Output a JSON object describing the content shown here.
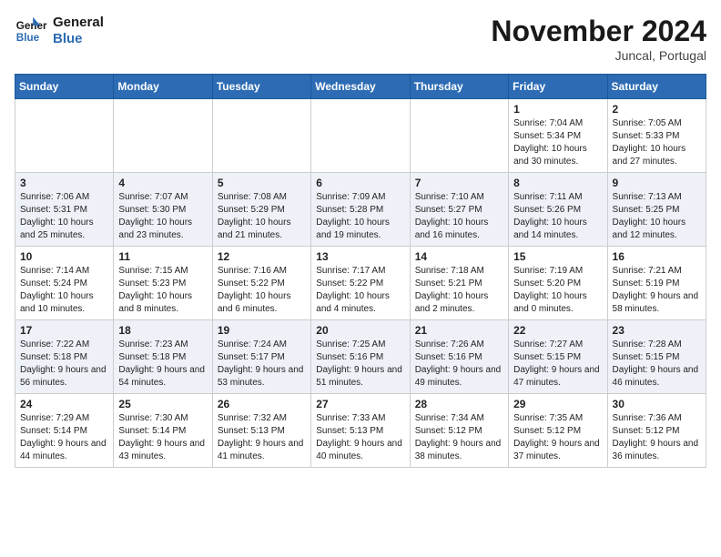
{
  "header": {
    "logo_line1": "General",
    "logo_line2": "Blue",
    "month": "November 2024",
    "location": "Juncal, Portugal"
  },
  "days_of_week": [
    "Sunday",
    "Monday",
    "Tuesday",
    "Wednesday",
    "Thursday",
    "Friday",
    "Saturday"
  ],
  "weeks": [
    [
      {
        "day": "",
        "info": ""
      },
      {
        "day": "",
        "info": ""
      },
      {
        "day": "",
        "info": ""
      },
      {
        "day": "",
        "info": ""
      },
      {
        "day": "",
        "info": ""
      },
      {
        "day": "1",
        "info": "Sunrise: 7:04 AM\nSunset: 5:34 PM\nDaylight: 10 hours and 30 minutes."
      },
      {
        "day": "2",
        "info": "Sunrise: 7:05 AM\nSunset: 5:33 PM\nDaylight: 10 hours and 27 minutes."
      }
    ],
    [
      {
        "day": "3",
        "info": "Sunrise: 7:06 AM\nSunset: 5:31 PM\nDaylight: 10 hours and 25 minutes."
      },
      {
        "day": "4",
        "info": "Sunrise: 7:07 AM\nSunset: 5:30 PM\nDaylight: 10 hours and 23 minutes."
      },
      {
        "day": "5",
        "info": "Sunrise: 7:08 AM\nSunset: 5:29 PM\nDaylight: 10 hours and 21 minutes."
      },
      {
        "day": "6",
        "info": "Sunrise: 7:09 AM\nSunset: 5:28 PM\nDaylight: 10 hours and 19 minutes."
      },
      {
        "day": "7",
        "info": "Sunrise: 7:10 AM\nSunset: 5:27 PM\nDaylight: 10 hours and 16 minutes."
      },
      {
        "day": "8",
        "info": "Sunrise: 7:11 AM\nSunset: 5:26 PM\nDaylight: 10 hours and 14 minutes."
      },
      {
        "day": "9",
        "info": "Sunrise: 7:13 AM\nSunset: 5:25 PM\nDaylight: 10 hours and 12 minutes."
      }
    ],
    [
      {
        "day": "10",
        "info": "Sunrise: 7:14 AM\nSunset: 5:24 PM\nDaylight: 10 hours and 10 minutes."
      },
      {
        "day": "11",
        "info": "Sunrise: 7:15 AM\nSunset: 5:23 PM\nDaylight: 10 hours and 8 minutes."
      },
      {
        "day": "12",
        "info": "Sunrise: 7:16 AM\nSunset: 5:22 PM\nDaylight: 10 hours and 6 minutes."
      },
      {
        "day": "13",
        "info": "Sunrise: 7:17 AM\nSunset: 5:22 PM\nDaylight: 10 hours and 4 minutes."
      },
      {
        "day": "14",
        "info": "Sunrise: 7:18 AM\nSunset: 5:21 PM\nDaylight: 10 hours and 2 minutes."
      },
      {
        "day": "15",
        "info": "Sunrise: 7:19 AM\nSunset: 5:20 PM\nDaylight: 10 hours and 0 minutes."
      },
      {
        "day": "16",
        "info": "Sunrise: 7:21 AM\nSunset: 5:19 PM\nDaylight: 9 hours and 58 minutes."
      }
    ],
    [
      {
        "day": "17",
        "info": "Sunrise: 7:22 AM\nSunset: 5:18 PM\nDaylight: 9 hours and 56 minutes."
      },
      {
        "day": "18",
        "info": "Sunrise: 7:23 AM\nSunset: 5:18 PM\nDaylight: 9 hours and 54 minutes."
      },
      {
        "day": "19",
        "info": "Sunrise: 7:24 AM\nSunset: 5:17 PM\nDaylight: 9 hours and 53 minutes."
      },
      {
        "day": "20",
        "info": "Sunrise: 7:25 AM\nSunset: 5:16 PM\nDaylight: 9 hours and 51 minutes."
      },
      {
        "day": "21",
        "info": "Sunrise: 7:26 AM\nSunset: 5:16 PM\nDaylight: 9 hours and 49 minutes."
      },
      {
        "day": "22",
        "info": "Sunrise: 7:27 AM\nSunset: 5:15 PM\nDaylight: 9 hours and 47 minutes."
      },
      {
        "day": "23",
        "info": "Sunrise: 7:28 AM\nSunset: 5:15 PM\nDaylight: 9 hours and 46 minutes."
      }
    ],
    [
      {
        "day": "24",
        "info": "Sunrise: 7:29 AM\nSunset: 5:14 PM\nDaylight: 9 hours and 44 minutes."
      },
      {
        "day": "25",
        "info": "Sunrise: 7:30 AM\nSunset: 5:14 PM\nDaylight: 9 hours and 43 minutes."
      },
      {
        "day": "26",
        "info": "Sunrise: 7:32 AM\nSunset: 5:13 PM\nDaylight: 9 hours and 41 minutes."
      },
      {
        "day": "27",
        "info": "Sunrise: 7:33 AM\nSunset: 5:13 PM\nDaylight: 9 hours and 40 minutes."
      },
      {
        "day": "28",
        "info": "Sunrise: 7:34 AM\nSunset: 5:12 PM\nDaylight: 9 hours and 38 minutes."
      },
      {
        "day": "29",
        "info": "Sunrise: 7:35 AM\nSunset: 5:12 PM\nDaylight: 9 hours and 37 minutes."
      },
      {
        "day": "30",
        "info": "Sunrise: 7:36 AM\nSunset: 5:12 PM\nDaylight: 9 hours and 36 minutes."
      }
    ]
  ]
}
